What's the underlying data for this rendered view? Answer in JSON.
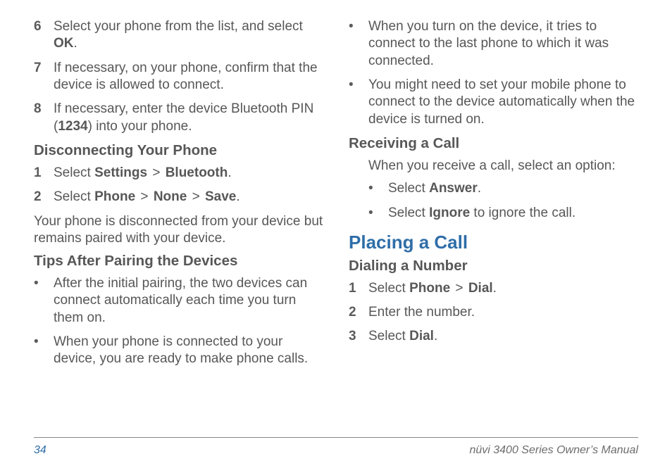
{
  "left": {
    "contSteps": {
      "s6": {
        "num": "6",
        "pre": "Select your phone from the list, and select ",
        "b1": "OK",
        "post": "."
      },
      "s7": {
        "num": "7",
        "text": "If necessary, on your phone, confirm that the device is allowed to connect."
      },
      "s8": {
        "num": "8",
        "pre": "If necessary, enter the device Bluetooth PIN (",
        "b1": "1234",
        "post": ") into your phone."
      }
    },
    "disconnect": {
      "heading": "Disconnecting Your Phone",
      "s1": {
        "num": "1",
        "pre": "Select ",
        "b1": "Settings",
        "gt1": " > ",
        "b2": "Bluetooth",
        "post": "."
      },
      "s2": {
        "num": "2",
        "pre": "Select ",
        "b1": "Phone",
        "gt1": " > ",
        "b2": "None",
        "gt2": " > ",
        "b3": "Save",
        "post": "."
      },
      "note": "Your phone is disconnected from your device but remains paired with your device."
    },
    "tips": {
      "heading": "Tips After Pairing the Devices",
      "b1": "After the initial pairing, the two devices can connect automatically each time you turn them on.",
      "b2": "When your phone is connected to your device, you are ready to make phone calls."
    }
  },
  "right": {
    "tipsCont": {
      "b1": "When you turn on the device, it tries to connect to the last phone to which it was connected.",
      "b2": "You might need to set your mobile phone to connect to the device automatically when the device is turned on."
    },
    "receiving": {
      "heading": "Receiving a Call",
      "intro": "When you receive a call, select an option:",
      "o1": {
        "pre": "Select ",
        "b1": "Answer",
        "post": "."
      },
      "o2": {
        "pre": "Select ",
        "b1": "Ignore",
        "post": " to ignore the call."
      }
    },
    "placing": {
      "heading": "Placing a Call"
    },
    "dialing": {
      "heading": "Dialing a Number",
      "s1": {
        "num": "1",
        "pre": "Select ",
        "b1": "Phone",
        "gt1": " > ",
        "b2": "Dial",
        "post": "."
      },
      "s2": {
        "num": "2",
        "text": "Enter the number."
      },
      "s3": {
        "num": "3",
        "pre": "Select ",
        "b1": "Dial",
        "post": "."
      }
    }
  },
  "footer": {
    "page": "34",
    "title": "nüvi 3400 Series Owner’s Manual"
  },
  "marks": {
    "bullet": "•"
  }
}
